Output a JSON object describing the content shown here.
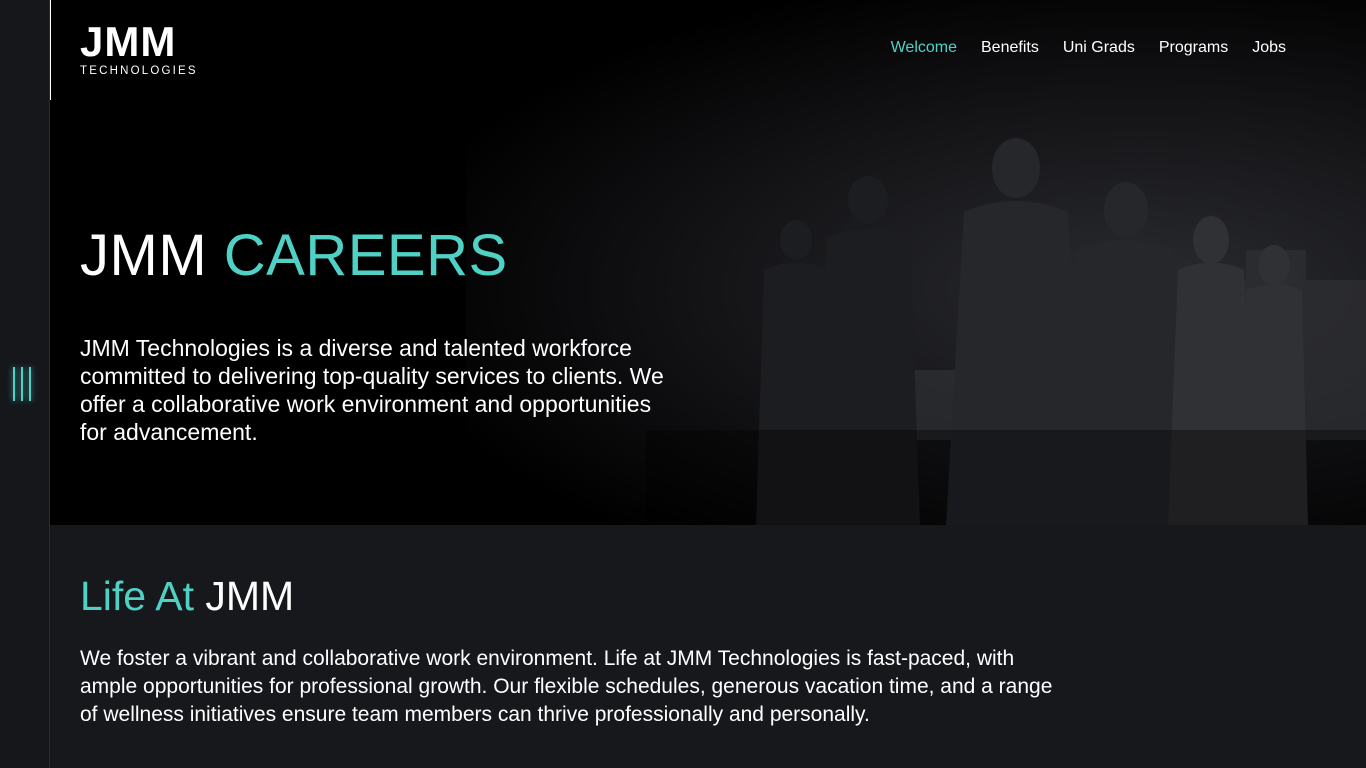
{
  "logo": {
    "main": "JMM",
    "sub": "TECHNOLOGIES"
  },
  "nav": {
    "items": [
      {
        "label": "Welcome",
        "active": true
      },
      {
        "label": "Benefits",
        "active": false
      },
      {
        "label": "Uni Grads",
        "active": false
      },
      {
        "label": "Programs",
        "active": false
      },
      {
        "label": "Jobs",
        "active": false
      }
    ]
  },
  "hero": {
    "title_plain": "JMM",
    "title_accent": "CAREERS",
    "text": "JMM Technologies is a diverse and talented workforce committed to delivering top-quality services to clients. We offer a collaborative work environment and opportunities for advancement."
  },
  "life": {
    "title_accent": "Life At",
    "title_plain": "JMM",
    "text": "We foster a vibrant and collaborative work environment. Life at JMM Technologies is fast-paced, with ample opportunities for professional growth. Our flexible schedules, generous vacation time, and a range of wellness initiatives ensure team members can thrive professionally and personally."
  },
  "colors": {
    "accent": "#4fd1c5",
    "hero_bg": "#000000",
    "page_bg": "#17181c",
    "text": "#ffffff"
  },
  "icons": {
    "rail_toggle": "menu-bars-icon"
  }
}
